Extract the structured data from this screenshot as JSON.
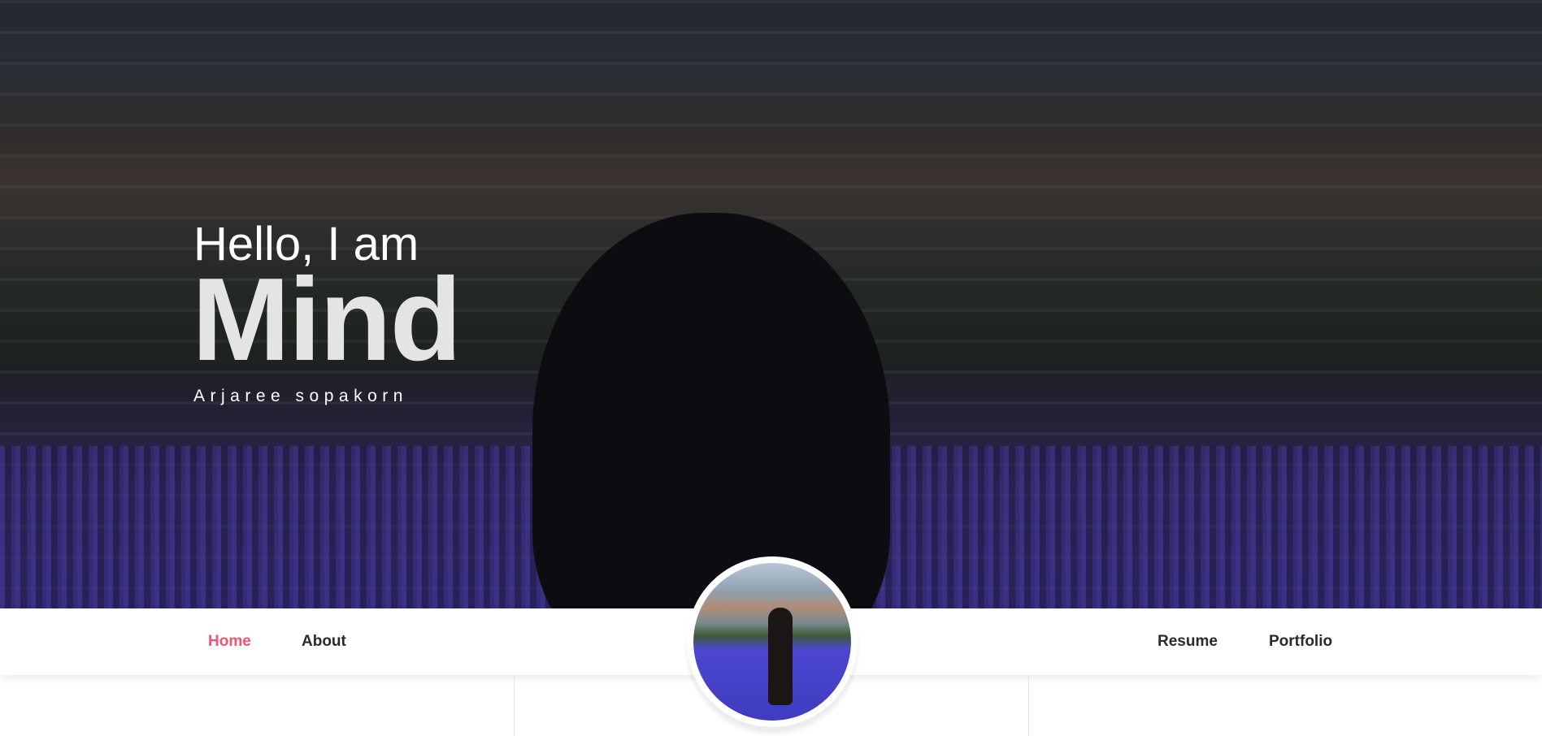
{
  "hero": {
    "greeting": "Hello, I am",
    "name": "Mind",
    "full_name": "Arjaree sopakorn"
  },
  "nav": {
    "items": [
      {
        "label": "Home",
        "active": true
      },
      {
        "label": "About",
        "active": false
      },
      {
        "label": "Resume",
        "active": false
      },
      {
        "label": "Portfolio",
        "active": false
      }
    ]
  },
  "colors": {
    "accent": "#f25471",
    "nav_text": "#2a2a2a"
  }
}
